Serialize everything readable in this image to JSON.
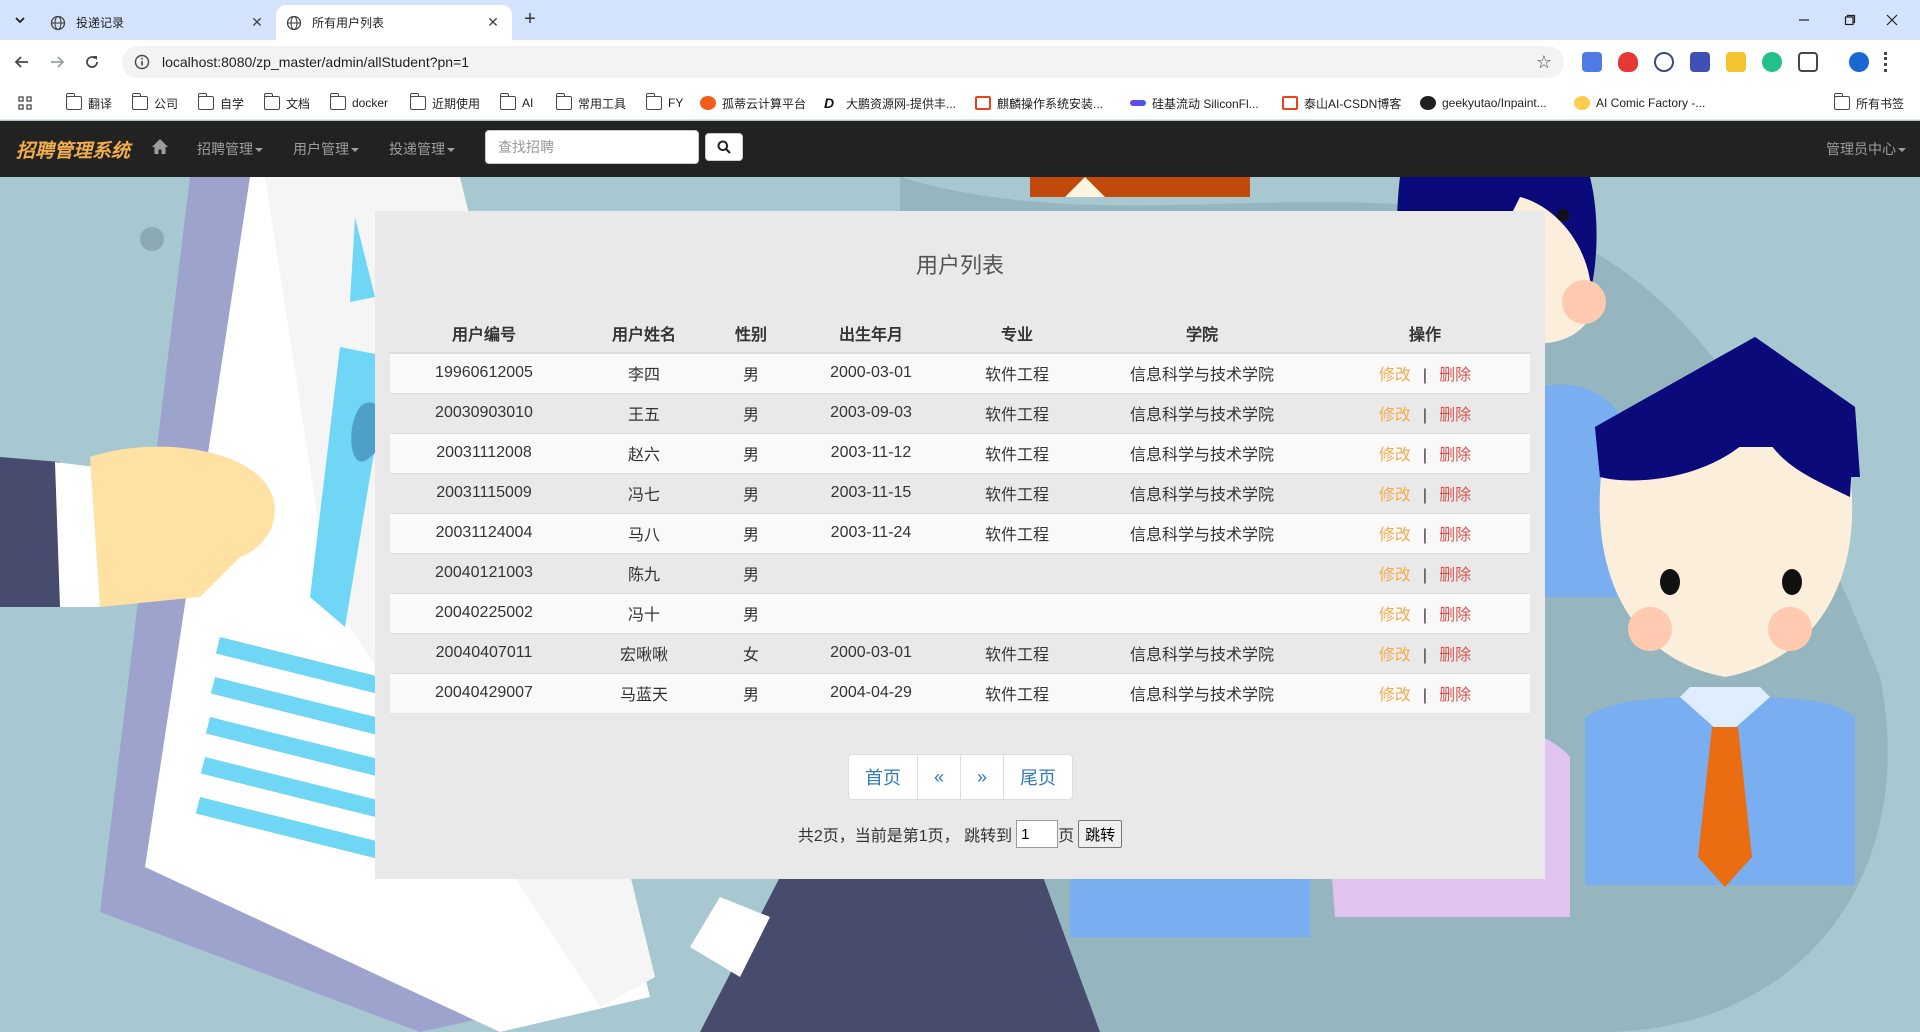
{
  "browser": {
    "tabs": [
      {
        "title": "投递记录",
        "active": false
      },
      {
        "title": "所有用户列表",
        "active": true
      }
    ],
    "url": "localhost:8080/zp_master/admin/allStudent?pn=1",
    "bookmarks": [
      {
        "label": "翻译",
        "icon": "folder-icon"
      },
      {
        "label": "公司",
        "icon": "folder-icon"
      },
      {
        "label": "自学",
        "icon": "folder-icon"
      },
      {
        "label": "文档",
        "icon": "folder-icon"
      },
      {
        "label": "docker",
        "icon": "folder-icon"
      },
      {
        "label": "近期使用",
        "icon": "folder-icon"
      },
      {
        "label": "AI",
        "icon": "folder-icon"
      },
      {
        "label": "常用工具",
        "icon": "folder-icon"
      },
      {
        "label": "FY",
        "icon": "folder-icon"
      },
      {
        "label": "孤蒂云计算平台",
        "icon": "site-icon"
      },
      {
        "label": "大鹏资源网-提供丰...",
        "icon": "site-icon"
      },
      {
        "label": "麒麟操作系统安装...",
        "icon": "site-icon"
      },
      {
        "label": "硅基流动 SiliconFl...",
        "icon": "site-icon"
      },
      {
        "label": "泰山AI-CSDN博客",
        "icon": "site-icon"
      },
      {
        "label": "geekyutao/Inpaint...",
        "icon": "github-icon"
      },
      {
        "label": "AI Comic Factory -...",
        "icon": "site-icon"
      }
    ],
    "all_bookmarks": "所有书签"
  },
  "app": {
    "brand": "招聘管理系统",
    "nav": {
      "recruit": "招聘管理",
      "users": "用户管理",
      "delivery": "投递管理",
      "admin": "管理员中心"
    },
    "search_placeholder": "查找招聘"
  },
  "panel": {
    "title": "用户列表",
    "columns": [
      "用户编号",
      "用户姓名",
      "性别",
      "出生年月",
      "专业",
      "学院",
      "操作"
    ],
    "edit_label": "修改",
    "separator": "|",
    "delete_label": "删除",
    "rows": [
      {
        "id": "19960612005",
        "name": "李四",
        "gender": "男",
        "birth": "2000-03-01",
        "major": "软件工程",
        "college": "信息科学与技术学院"
      },
      {
        "id": "20030903010",
        "name": "王五",
        "gender": "男",
        "birth": "2003-09-03",
        "major": "软件工程",
        "college": "信息科学与技术学院"
      },
      {
        "id": "20031112008",
        "name": "赵六",
        "gender": "男",
        "birth": "2003-11-12",
        "major": "软件工程",
        "college": "信息科学与技术学院"
      },
      {
        "id": "20031115009",
        "name": "冯七",
        "gender": "男",
        "birth": "2003-11-15",
        "major": "软件工程",
        "college": "信息科学与技术学院"
      },
      {
        "id": "20031124004",
        "name": "马八",
        "gender": "男",
        "birth": "2003-11-24",
        "major": "软件工程",
        "college": "信息科学与技术学院"
      },
      {
        "id": "20040121003",
        "name": "陈九",
        "gender": "男",
        "birth": "",
        "major": "",
        "college": ""
      },
      {
        "id": "20040225002",
        "name": "冯十",
        "gender": "男",
        "birth": "",
        "major": "",
        "college": ""
      },
      {
        "id": "20040407011",
        "name": "宏啾啾",
        "gender": "女",
        "birth": "2000-03-01",
        "major": "软件工程",
        "college": "信息科学与技术学院"
      },
      {
        "id": "20040429007",
        "name": "马蓝天",
        "gender": "男",
        "birth": "2004-04-29",
        "major": "软件工程",
        "college": "信息科学与技术学院"
      }
    ],
    "pager": {
      "first": "首页",
      "prev": "«",
      "next": "»",
      "last": "尾页"
    },
    "jump": {
      "summary": "共2页，当前是第1页，  跳转到",
      "value": "1",
      "unit": "页",
      "button": "跳转"
    }
  }
}
